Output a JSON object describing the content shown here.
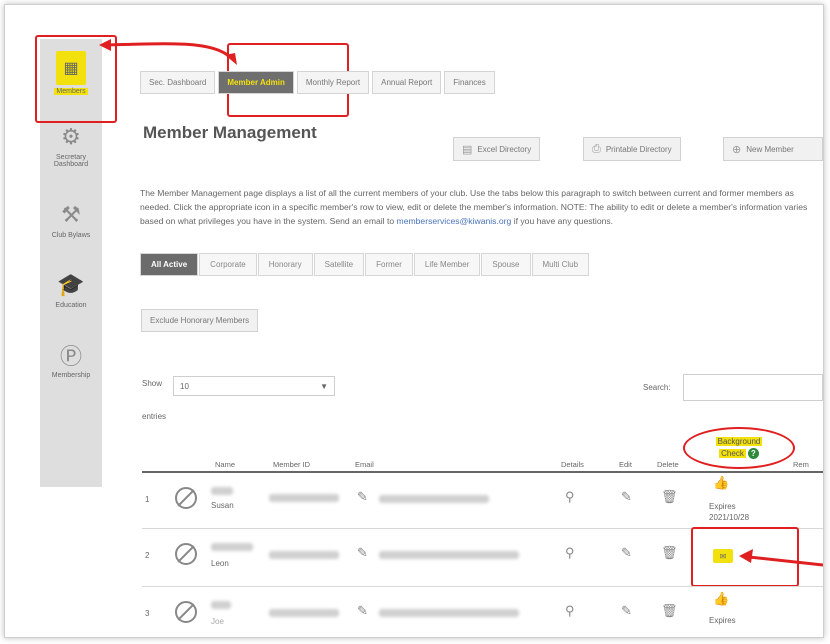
{
  "sidebar": {
    "items": [
      {
        "label": "Members",
        "icon": "members-book-icon"
      },
      {
        "label": "Secretary Dashboard",
        "icon": "gear-icon"
      },
      {
        "label": "Club Bylaws",
        "icon": "gavel-icon"
      },
      {
        "label": "Education",
        "icon": "graduation-cap-icon"
      },
      {
        "label": "Membership",
        "icon": "kiwanis-logo-icon"
      }
    ]
  },
  "top_tabs": [
    "Sec. Dashboard",
    "Member Admin",
    "Monthly Report",
    "Annual Report",
    "Finances"
  ],
  "page_title": "Member Management",
  "actions": {
    "excel": "Excel Directory",
    "printable": "Printable Directory",
    "new_member": "New Member"
  },
  "description": {
    "text": "The Member Management page displays a list of all the current members of your club. Use the tabs below this paragraph to switch between current and former members as needed. Click the appropriate icon in a specific member's row to view, edit or delete the member's information. NOTE: The ability to edit or delete a member's information varies based on what privileges you have in the system. Send an email to",
    "email": "memberservices@kiwanis.org",
    "suffix": "if you have any questions."
  },
  "filter_tabs": [
    "All Active",
    "Corporate",
    "Honorary",
    "Satellite",
    "Former",
    "Life Member",
    "Spouse",
    "Multi Club"
  ],
  "exclude_button": "Exclude Honorary Members",
  "table_controls": {
    "show_label": "Show",
    "show_value": "10",
    "entries_label": "entries",
    "search_label": "Search:"
  },
  "background_check": {
    "line1": "Background",
    "line2": "Check"
  },
  "columns": [
    "Name",
    "Member ID",
    "Email",
    "Details",
    "Edit",
    "Delete",
    "Rem"
  ],
  "rows": [
    {
      "num": "1",
      "name": "Susan",
      "status_line1": "Expires",
      "status_line2": "2021/10/28"
    },
    {
      "num": "2",
      "name": "Leon",
      "status_line1": "",
      "status_line2": ""
    },
    {
      "num": "3",
      "name": "Joe",
      "status_line1": "Expires",
      "status_line2": ""
    }
  ],
  "colors": {
    "highlight": "#f3e10d",
    "annotation_red": "#e02020",
    "active_tab": "#6b6b6b"
  }
}
